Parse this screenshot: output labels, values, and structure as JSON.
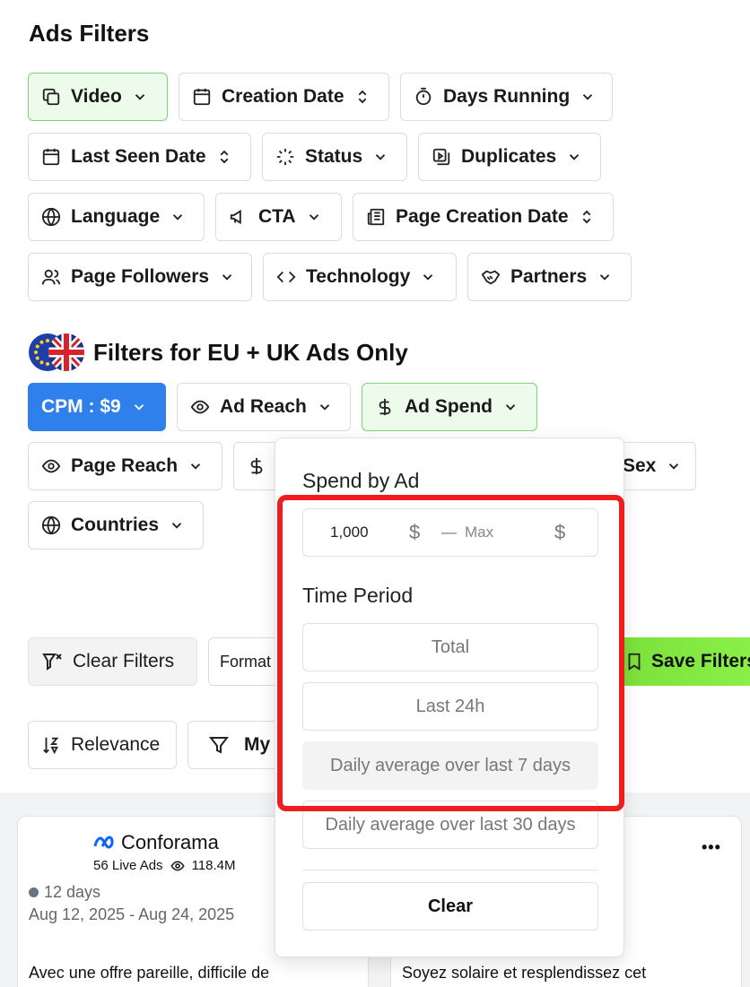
{
  "header": {
    "title": "Ads Filters"
  },
  "filters": {
    "video": "Video",
    "creation_date": "Creation Date",
    "days_running": "Days Running",
    "last_seen_date": "Last Seen Date",
    "status": "Status",
    "duplicates": "Duplicates",
    "language": "Language",
    "cta": "CTA",
    "page_creation_date": "Page Creation Date",
    "page_followers": "Page Followers",
    "technology": "Technology",
    "partners": "Partners"
  },
  "eu": {
    "title": "Filters for EU + UK Ads Only",
    "cpm": "CPM : $9",
    "ad_reach": "Ad Reach",
    "ad_spend": "Ad Spend",
    "page_reach": "Page Reach",
    "dollar_partial": "$",
    "sex_partial": "Sex",
    "countries": "Countries"
  },
  "actions": {
    "clear_filters": "Clear Filters",
    "format_partial": "Format",
    "save_filters": "Save Filters",
    "relevance": "Relevance",
    "my_partial": "My"
  },
  "popup": {
    "spend_title": "Spend by Ad",
    "min_value": "1,000",
    "currency": "$",
    "dash": "—",
    "max_placeholder": "Max",
    "time_title": "Time Period",
    "options": [
      "Total",
      "Last 24h",
      "Daily average over last 7 days",
      "Daily average over last 30 days"
    ],
    "selected_index": 2,
    "clear": "Clear"
  },
  "cards": [
    {
      "brand": "Conforama",
      "live_ads": "56 Live Ads",
      "reach": "118.4M",
      "days": "12 days",
      "dates": "Aug 12, 2025 - Aug 24, 2025",
      "text": "Avec une offre pareille, difficile de"
    },
    {
      "text": "Soyez solaire et resplendissez cet",
      "menu": "•••"
    }
  ],
  "colors": {
    "accent_blue": "#2f80ed",
    "active_green_bg": "#ecfbea",
    "highlight_red": "#ef1d1d",
    "save_green": "#7be03a"
  }
}
